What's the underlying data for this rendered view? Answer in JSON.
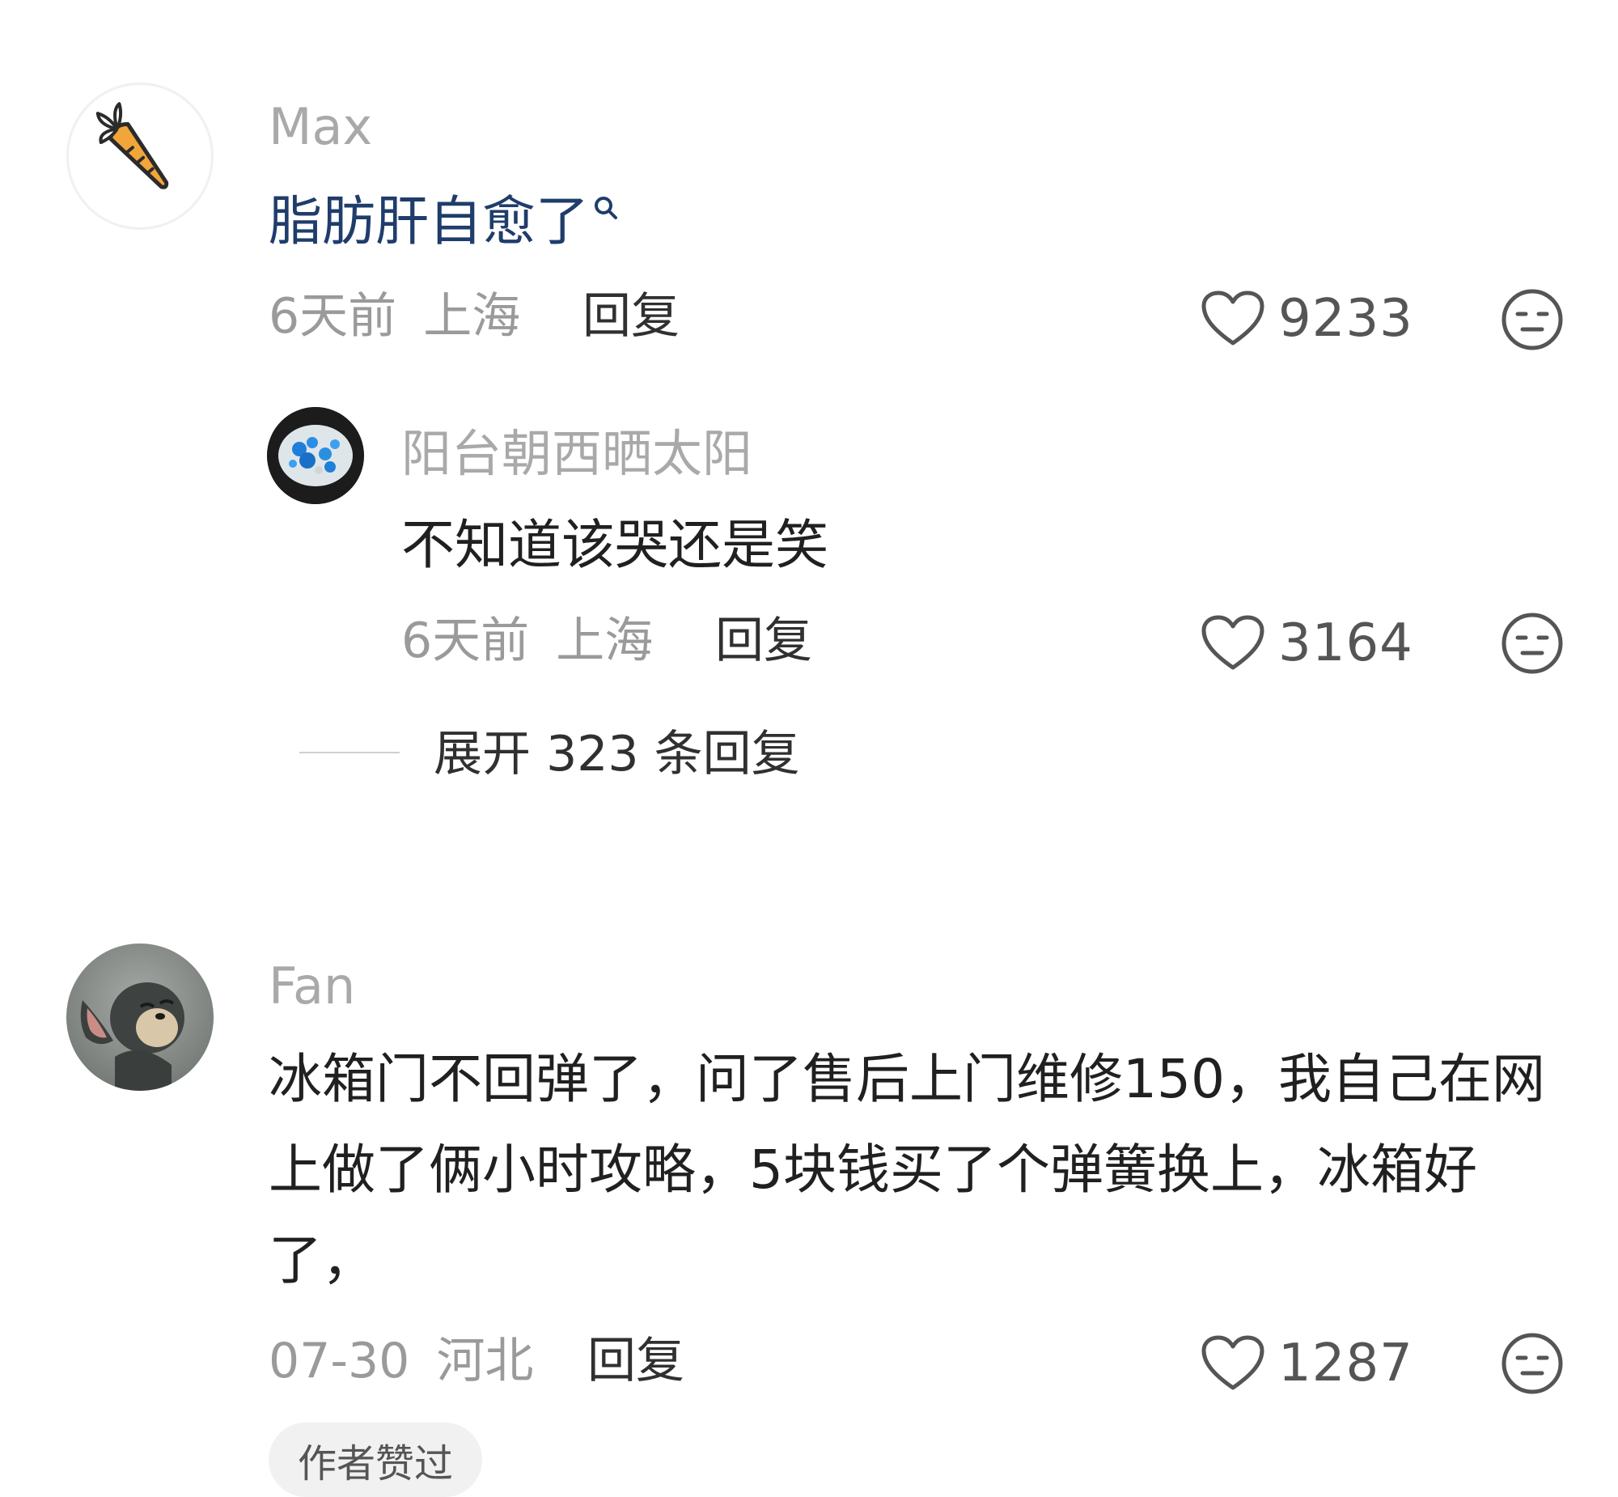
{
  "comments": [
    {
      "user": "Max",
      "text": "脂肪肝自愈了",
      "time": "6天前",
      "location": "上海",
      "reply_label": "回复",
      "likes": "9233",
      "reply": {
        "user": "阳台朝西晒太阳",
        "text": "不知道该哭还是笑",
        "time": "6天前",
        "location": "上海",
        "reply_label": "回复",
        "likes": "3164"
      },
      "expand_label": "展开 323 条回复"
    },
    {
      "user": "Fan",
      "text": "冰箱门不回弹了，问了售后上门维修150，我自己在网上做了俩小时攻略，5块钱买了个弹簧换上，冰箱好了，",
      "time": "07-30",
      "location": "河北",
      "reply_label": "回复",
      "likes": "1287",
      "badge": "作者赞过"
    }
  ],
  "icons": {
    "avatar_max": "carrot-icon",
    "avatar_reply": "blue-crystal-avatar",
    "avatar_fan": "cartoon-cat-avatar",
    "search_link": "search-icon",
    "like": "heart-icon",
    "dislike": "neutral-face-icon"
  },
  "colors": {
    "link_text": "#1f3d6b",
    "username": "#a9a9a9",
    "meta": "#9a9a9a",
    "badge_bg": "#f1f1f1"
  }
}
